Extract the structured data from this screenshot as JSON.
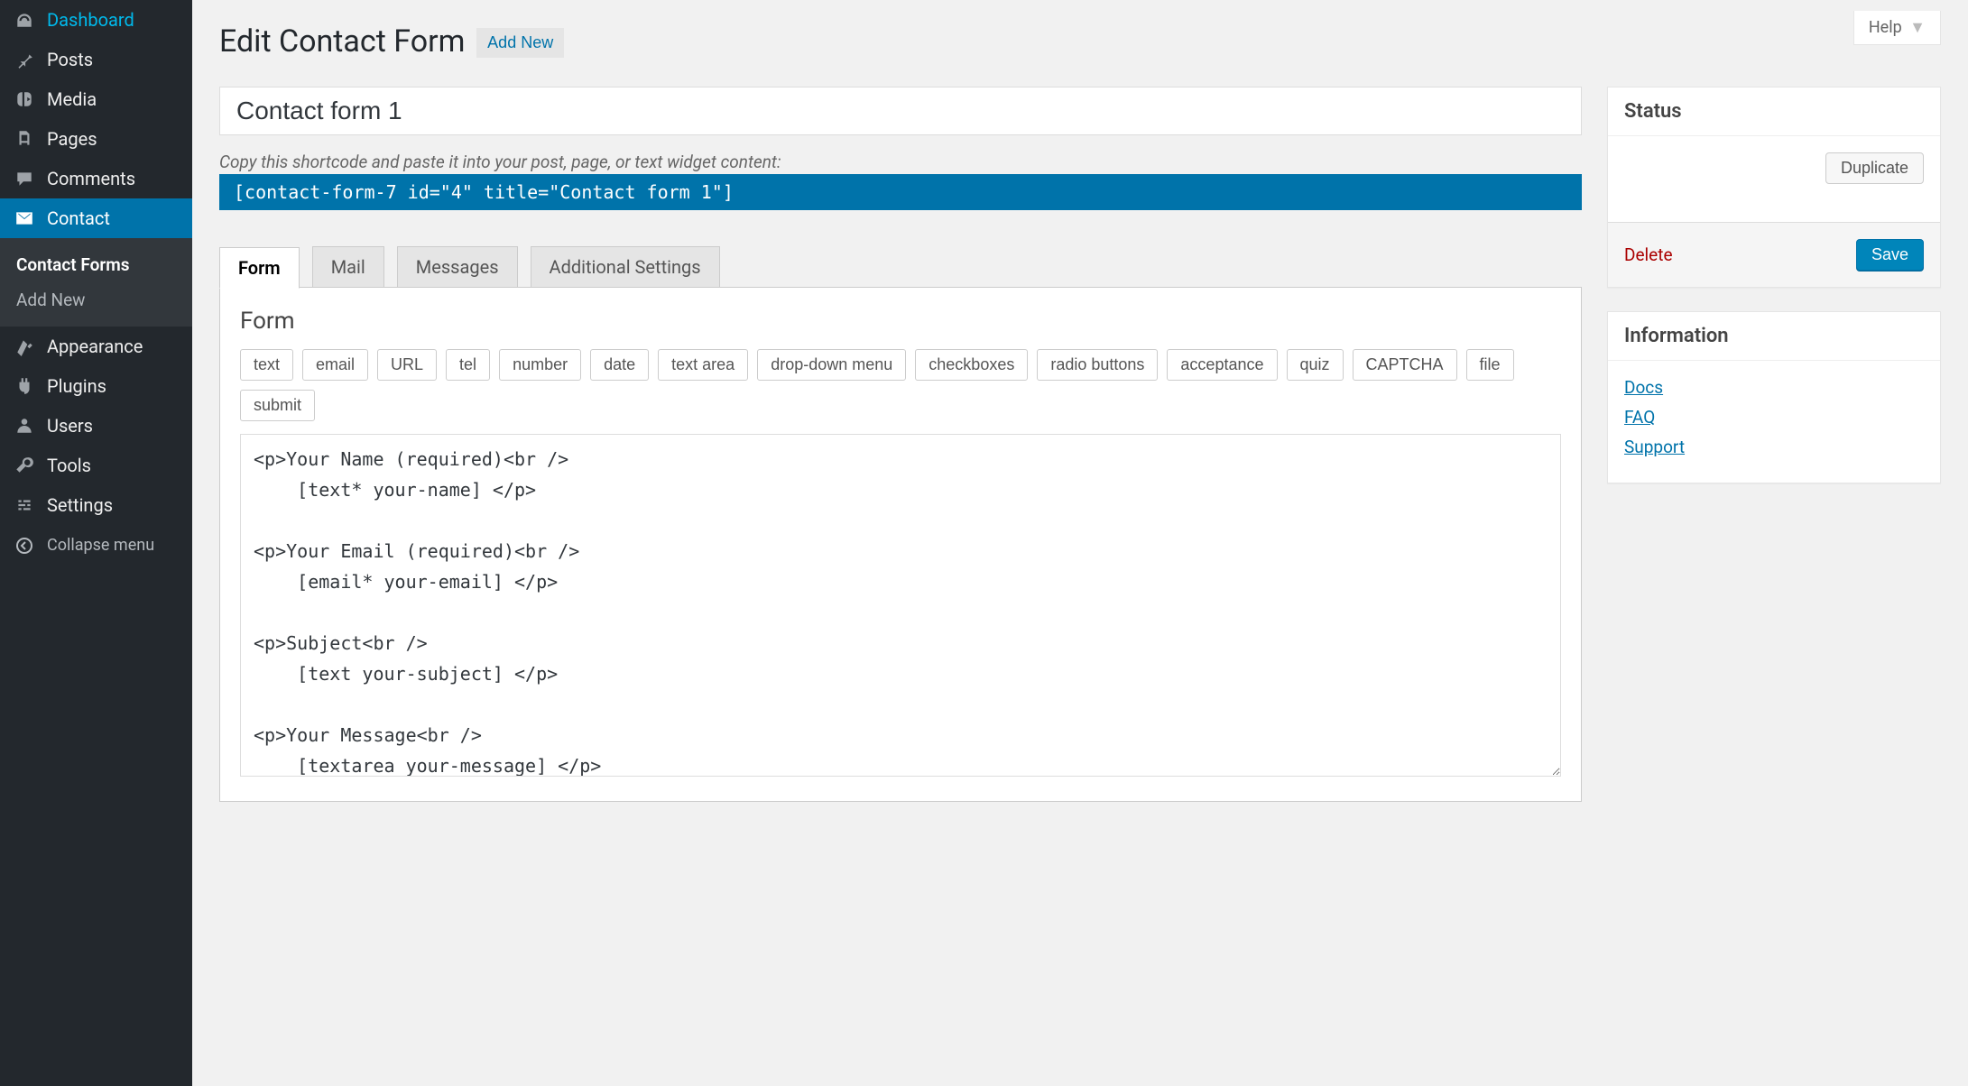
{
  "help_label": "Help",
  "sidebar": {
    "items": [
      {
        "label": "Dashboard",
        "icon": "dashboard"
      },
      {
        "label": "Posts",
        "icon": "pin"
      },
      {
        "label": "Media",
        "icon": "media"
      },
      {
        "label": "Pages",
        "icon": "pages"
      },
      {
        "label": "Comments",
        "icon": "comment"
      },
      {
        "label": "Contact",
        "icon": "mail",
        "active": true,
        "sub": [
          {
            "label": "Contact Forms",
            "current": true
          },
          {
            "label": "Add New"
          }
        ]
      },
      {
        "label": "Appearance",
        "icon": "appearance"
      },
      {
        "label": "Plugins",
        "icon": "plugins"
      },
      {
        "label": "Users",
        "icon": "users"
      },
      {
        "label": "Tools",
        "icon": "tools"
      },
      {
        "label": "Settings",
        "icon": "settings"
      }
    ],
    "collapse_label": "Collapse menu"
  },
  "page": {
    "title": "Edit Contact Form",
    "add_new": "Add New"
  },
  "form": {
    "title_value": "Contact form 1",
    "shortcode_hint": "Copy this shortcode and paste it into your post, page, or text widget content:",
    "shortcode": "[contact-form-7 id=\"4\" title=\"Contact form 1\"]",
    "tabs": [
      "Form",
      "Mail",
      "Messages",
      "Additional Settings"
    ],
    "active_tab": "Form",
    "panel_heading": "Form",
    "tag_buttons": [
      "text",
      "email",
      "URL",
      "tel",
      "number",
      "date",
      "text area",
      "drop-down menu",
      "checkboxes",
      "radio buttons",
      "acceptance",
      "quiz",
      "CAPTCHA",
      "file",
      "submit"
    ],
    "textarea_value": "<p>Your Name (required)<br />\n    [text* your-name] </p>\n\n<p>Your Email (required)<br />\n    [email* your-email] </p>\n\n<p>Subject<br />\n    [text your-subject] </p>\n\n<p>Your Message<br />\n    [textarea your-message] </p>\n\n<p>[submit \"Send\"]</p>"
  },
  "status_box": {
    "title": "Status",
    "duplicate": "Duplicate",
    "delete": "Delete",
    "save": "Save"
  },
  "info_box": {
    "title": "Information",
    "links": [
      "Docs",
      "FAQ",
      "Support"
    ]
  }
}
